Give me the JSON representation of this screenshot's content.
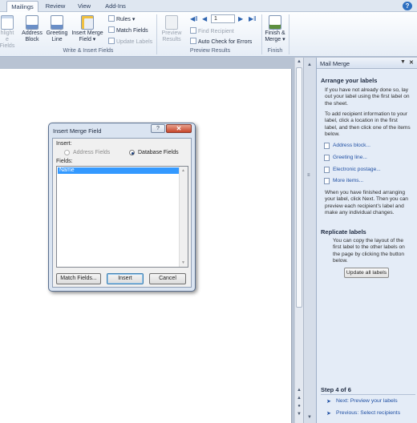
{
  "tabs": [
    "Mailings",
    "Review",
    "View",
    "Add-Ins"
  ],
  "ribbon": {
    "highlight": [
      "hlight",
      "e Fields"
    ],
    "address_block": [
      "Address",
      "Block"
    ],
    "greeting_line": [
      "Greeting",
      "Line"
    ],
    "insert_merge_field": [
      "Insert Merge",
      "Field ▾"
    ],
    "rules": "Rules ▾",
    "match_fields": "Match Fields",
    "update_labels": "Update Labels",
    "group_write_insert": "Write & Insert Fields",
    "preview_results": [
      "Preview",
      "Results"
    ],
    "record_number": "1",
    "find_recipient": "Find Recipient",
    "auto_check": "Auto Check for Errors",
    "group_preview": "Preview Results",
    "finish_merge": [
      "Finish &",
      "Merge ▾"
    ],
    "group_finish": "Finish"
  },
  "dialog": {
    "title": "Insert Merge Field",
    "help": "?",
    "close": "✕",
    "insert_label": "Insert:",
    "address_fields": "Address Fields",
    "database_fields": "Database Fields",
    "fields_label": "Fields:",
    "fields": [
      "Name"
    ],
    "match_fields_btn": "Match Fields...",
    "insert_btn": "Insert",
    "cancel_btn": "Cancel"
  },
  "pane": {
    "title": "Mail Merge",
    "arrange_heading": "Arrange your labels",
    "arrange_text1": "If you have not already done so, lay out your label using the first label on the sheet.",
    "arrange_text2": "To add recipient information to your label, click a location in the first label, and then click one of the items below.",
    "links": [
      "Address block...",
      "Greeting line...",
      "Electronic postage...",
      "More items..."
    ],
    "arrange_text3": "When you have finished arranging your label, click Next. Then you can preview each recipient's label and make any individual changes.",
    "replicate_heading": "Replicate labels",
    "replicate_text": "You can copy the layout of the first label to the other labels on the page by clicking the button below.",
    "update_all_btn": "Update all labels",
    "step": "Step 4 of 6",
    "next_link": "Next: Preview your labels",
    "prev_link": "Previous: Select recipients"
  }
}
